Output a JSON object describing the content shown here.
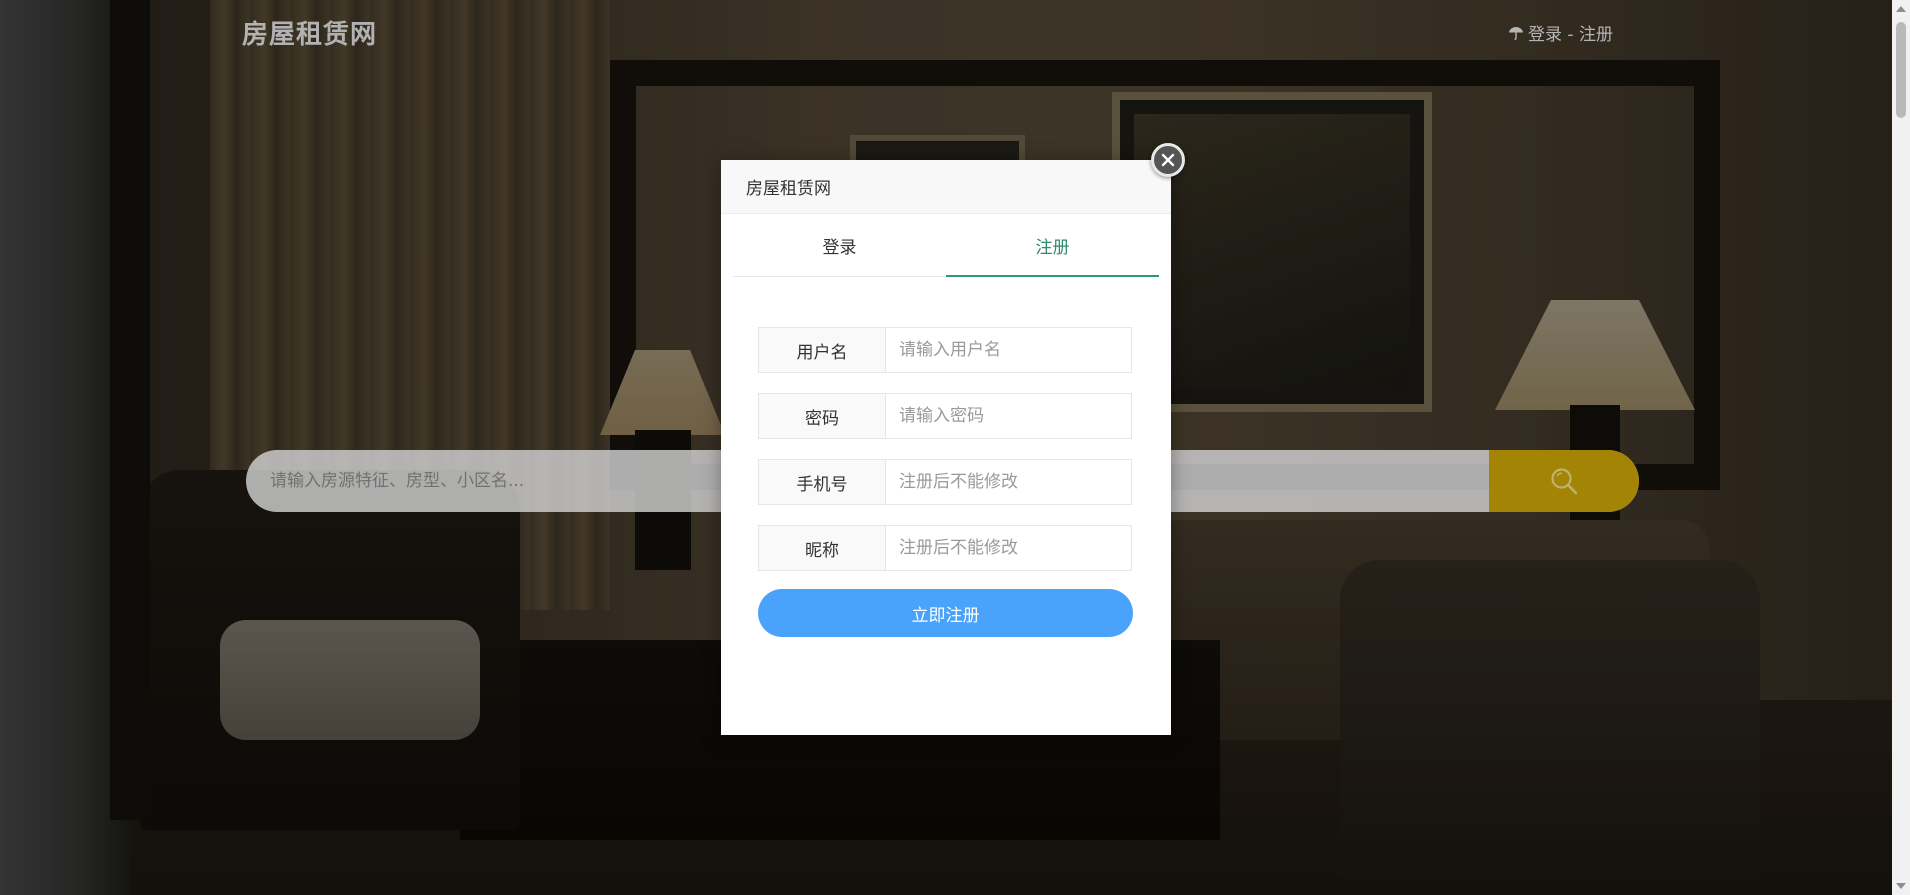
{
  "header": {
    "site_title": "房屋租赁网",
    "auth_link": "登录 - 注册",
    "auth_icon": "umbrella-icon"
  },
  "search": {
    "placeholder": "请输入房源特征、房型、小区名...",
    "button_icon": "search-icon",
    "button_color": "#c9a106"
  },
  "dialog": {
    "title": "房屋租赁网",
    "close_icon": "close-icon",
    "tabs": [
      {
        "label": "登录",
        "active": false
      },
      {
        "label": "注册",
        "active": true
      }
    ],
    "fields": [
      {
        "label": "用户名",
        "placeholder": "请输入用户名",
        "value": ""
      },
      {
        "label": "密码",
        "placeholder": "请输入密码",
        "value": ""
      },
      {
        "label": "手机号",
        "placeholder": "注册后不能修改",
        "value": ""
      },
      {
        "label": "昵称",
        "placeholder": "注册后不能修改",
        "value": ""
      }
    ],
    "submit_label": "立即注册",
    "accent_color": "#2f9a71",
    "submit_color": "#4aa3fb"
  }
}
